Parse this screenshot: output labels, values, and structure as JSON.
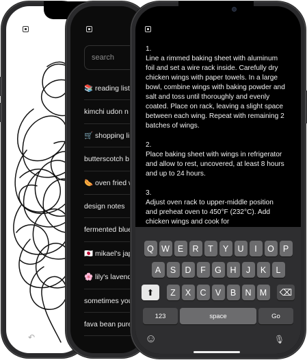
{
  "phone1": {
    "layout_icon": "sidebar-toggle-icon",
    "undo_icon": "undo-icon",
    "undo_glyph": "↶"
  },
  "phone2": {
    "layout_icon": "sidebar-toggle-icon",
    "search": {
      "placeholder": "search"
    },
    "notes": [
      {
        "label": "📚 reading list"
      },
      {
        "label": "kimchi udon n"
      },
      {
        "label": "🛒 shopping lis"
      },
      {
        "label": "butterscotch b"
      },
      {
        "label": "🌭 oven fried w"
      },
      {
        "label": "design notes"
      },
      {
        "label": "fermented blue"
      },
      {
        "label": "🇯🇵 mikael's jap"
      },
      {
        "label": "🌸 lily's lavende"
      },
      {
        "label": "sometimes you"
      },
      {
        "label": "fava bean pure"
      }
    ]
  },
  "phone3": {
    "layout_icon": "sidebar-toggle-icon",
    "note": {
      "steps": [
        {
          "number": "1.",
          "text": "Line a rimmed baking sheet with aluminum foil and set a wire rack inside. Carefully dry chicken wings with paper towels. In a large bowl, combine wings with baking powder and salt and toss until thoroughly and evenly coated. Place on rack, leaving a slight space between each wing. Repeat with remaining 2 batches of wings."
        },
        {
          "number": "2.",
          "text": "Place baking sheet with wings in refrigerator and allow to rest, uncovered, at least 8 hours and up to 24 hours."
        },
        {
          "number": "3.",
          "text": "Adjust oven rack to upper-middle position and preheat oven to 450°F (232°C). Add chicken wings and cook for"
        }
      ]
    },
    "keyboard": {
      "row1": [
        "Q",
        "W",
        "E",
        "R",
        "T",
        "Y",
        "U",
        "I",
        "O",
        "P"
      ],
      "row2": [
        "A",
        "S",
        "D",
        "F",
        "G",
        "H",
        "J",
        "K",
        "L"
      ],
      "row3": [
        "Z",
        "X",
        "C",
        "V",
        "B",
        "N",
        "M"
      ],
      "shift_glyph": "⬆",
      "delete_glyph": "⌫",
      "numbers_label": "123",
      "space_label": "space",
      "go_label": "Go",
      "emoji_glyph": "☺",
      "mic_glyph": "🎙"
    }
  }
}
